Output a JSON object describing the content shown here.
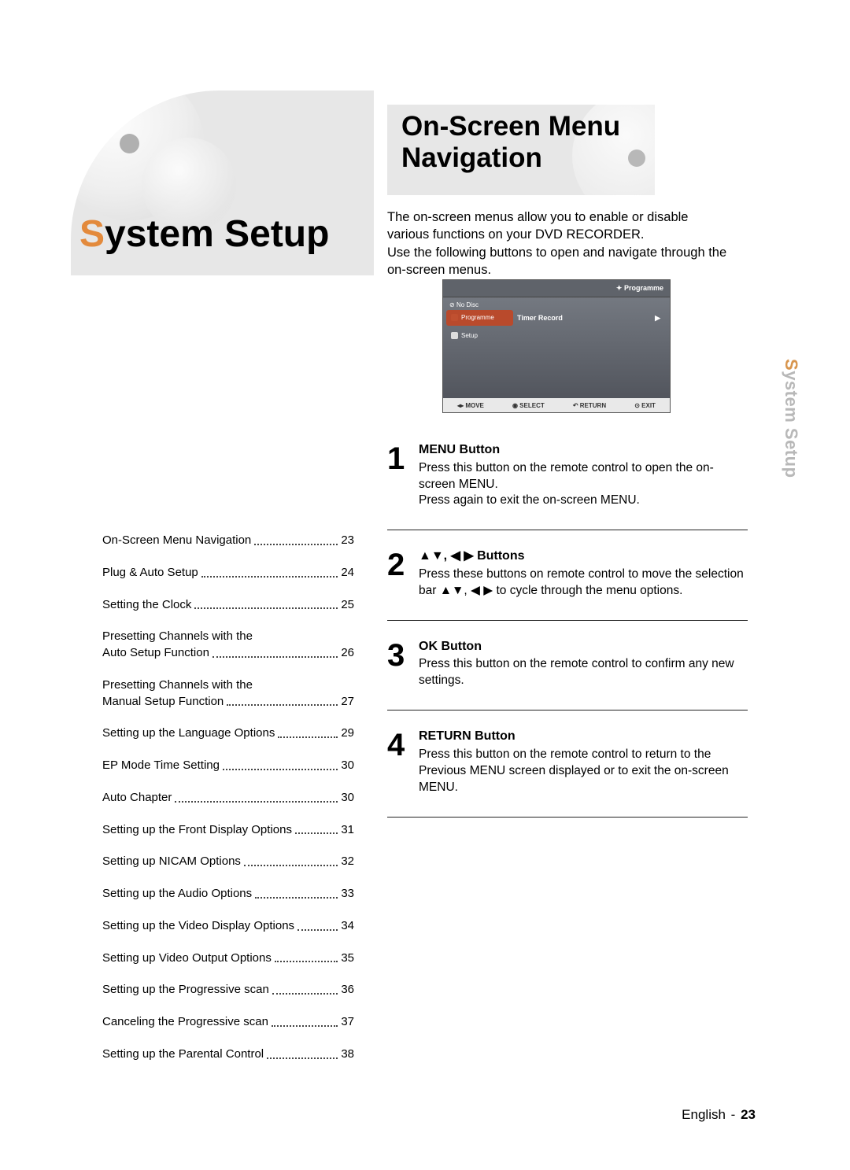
{
  "section": {
    "title_first": "S",
    "title_rest": "ystem Setup"
  },
  "article": {
    "title_l1": "On-Screen Menu",
    "title_l2": "Navigation"
  },
  "intro": "The on-screen menus allow you to enable or disable various functions on your DVD RECORDER.\nUse the following buttons to open and navigate through the on-screen menus.",
  "osd": {
    "header": "Programme",
    "nodisc": "No Disc",
    "side": {
      "programme": "Programme",
      "setup": "Setup"
    },
    "row": {
      "label": "Timer Record",
      "arrow": "▶"
    },
    "footer": {
      "move": "MOVE",
      "select": "SELECT",
      "return": "RETURN",
      "exit": "EXIT"
    }
  },
  "toc": [
    {
      "label": "On-Screen Menu Navigation",
      "page": "23"
    },
    {
      "label": "Plug & Auto Setup",
      "page": "24"
    },
    {
      "label": "Setting the Clock",
      "page": "25"
    },
    {
      "label": "Presetting Channels with the",
      "label2": "Auto Setup Function",
      "page": "26"
    },
    {
      "label": "Presetting Channels with the",
      "label2": "Manual Setup Function",
      "page": "27"
    },
    {
      "label": "Setting up the Language Options",
      "page": "29"
    },
    {
      "label": "EP Mode Time Setting",
      "page": "30"
    },
    {
      "label": "Auto Chapter",
      "page": "30"
    },
    {
      "label": "Setting up the Front Display Options",
      "page": "31"
    },
    {
      "label": "Setting up NICAM Options",
      "page": "32"
    },
    {
      "label": "Setting up the Audio Options",
      "page": "33"
    },
    {
      "label": "Setting up the Video Display Options",
      "page": "34"
    },
    {
      "label": "Setting up Video Output Options",
      "page": "35"
    },
    {
      "label": "Setting up the Progressive scan",
      "page": "36"
    },
    {
      "label": "Canceling the Progressive scan",
      "page": "37"
    },
    {
      "label": "Setting up the Parental Control",
      "page": "38"
    }
  ],
  "steps": [
    {
      "n": "1",
      "title": "MENU Button",
      "body": "Press this button on the remote control to open the on-screen MENU.\nPress again to exit the on-screen MENU."
    },
    {
      "n": "2",
      "title": "▲▼, ◀ ▶ Buttons",
      "body": "Press these buttons on remote control to move the selection bar ▲▼, ◀ ▶ to cycle through the menu options."
    },
    {
      "n": "3",
      "title": "OK Button",
      "body": "Press this button on the remote control to confirm any new settings."
    },
    {
      "n": "4",
      "title": "RETURN Button",
      "body": "Press this button on the remote control to return to the Previous MENU screen displayed or to exit the on-screen MENU."
    }
  ],
  "sidetab": {
    "first": "S",
    "rest": "ystem Setup"
  },
  "footer": {
    "lang": "English",
    "dash": "-",
    "page": "23"
  }
}
